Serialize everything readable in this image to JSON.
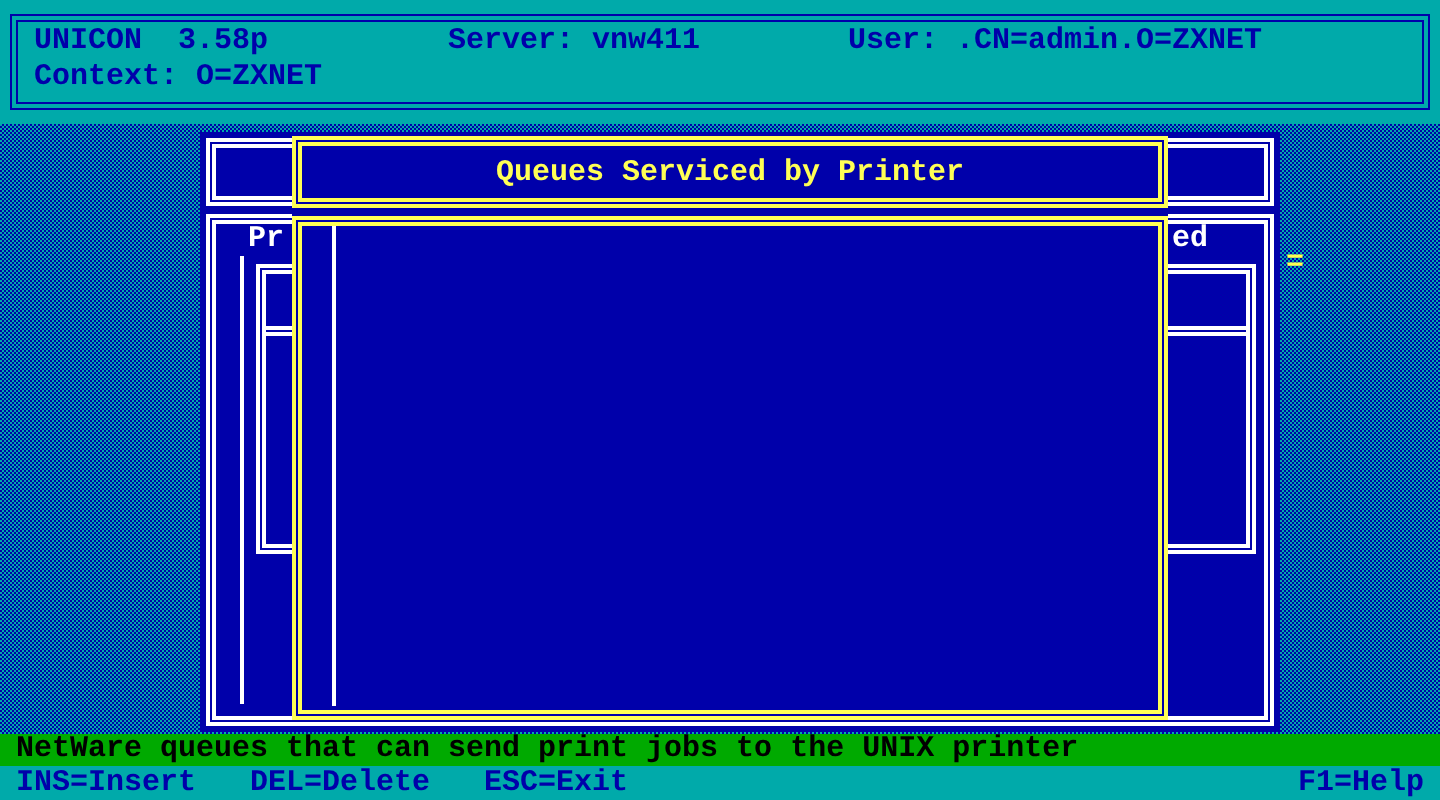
{
  "header": {
    "program": "UNICON  3.58p",
    "server": "Server: vnw411",
    "user": "User: .CN=admin.O=ZXNET",
    "context": "Context: O=ZXNET"
  },
  "back_window": {
    "label_left": "Pr",
    "label_right": "ed",
    "marker": "="
  },
  "dialog": {
    "title": "Queues Serviced by Printer"
  },
  "status_line": "NetWare queues that can send print jobs to the UNIX printer",
  "keys": [
    {
      "label": "INS=Insert"
    },
    {
      "label": "DEL=Delete"
    },
    {
      "label": "ESC=Exit"
    }
  ],
  "help": "F1=Help"
}
